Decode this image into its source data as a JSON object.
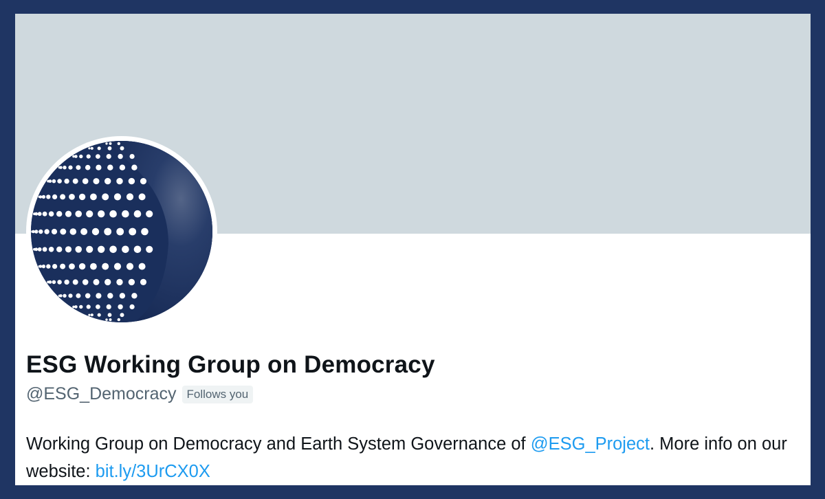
{
  "profile": {
    "display_name": "ESG Working Group on Democracy",
    "handle": "@ESG_Democracy",
    "follows_you_badge": "Follows you",
    "bio": {
      "part1": "Working Group on Democracy and Earth System Governance of ",
      "mention": "@ESG_Project",
      "part2": ". More info on our website: ",
      "link": "bit.ly/3UrCX0X"
    }
  },
  "colors": {
    "outer_frame": "#1f3563",
    "banner": "#cfd9de",
    "avatar_navy": "#1a2f5c",
    "link": "#1d9bf0",
    "text_primary": "#0f1419",
    "text_secondary": "#536471"
  },
  "icons": {
    "avatar": "dotted-globe-logo"
  }
}
